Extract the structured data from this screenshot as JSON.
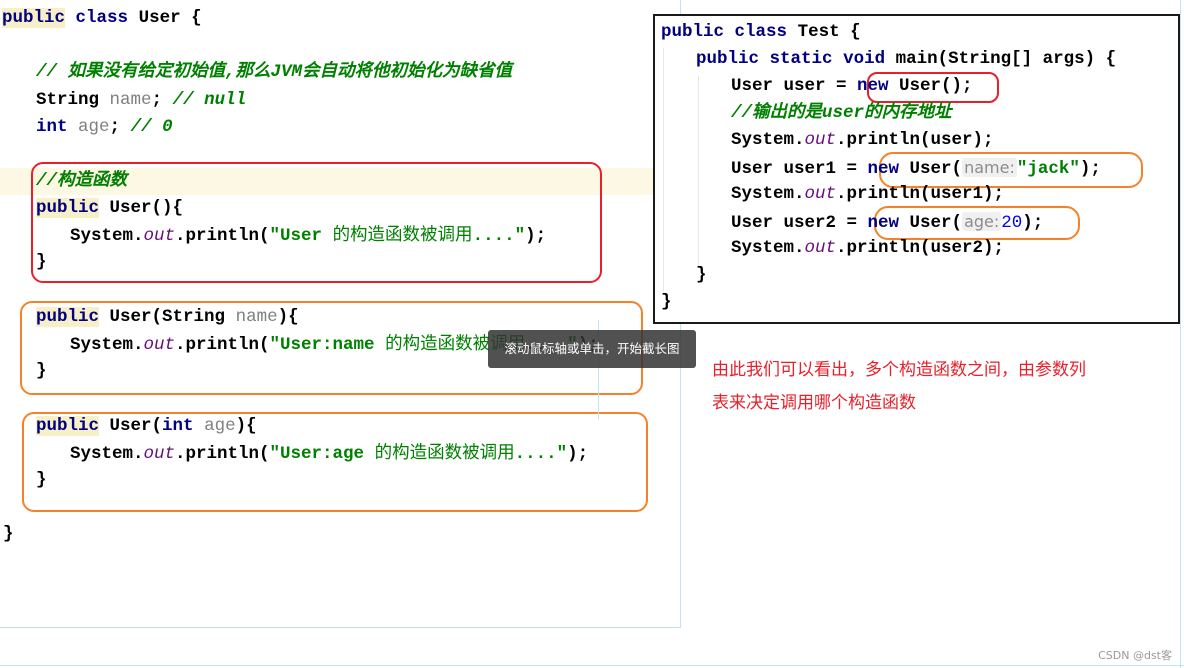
{
  "user_class": {
    "header": {
      "kw1": "public",
      "kw2": "class",
      "name": "User",
      "brace": "{"
    },
    "comment_default": "// 如果没有给定初始值,那么JVM会自动将他初始化为缺省值",
    "field_name": {
      "type": "String",
      "name": "name",
      "semi": ";",
      "comment": "// null"
    },
    "field_age": {
      "type": "int",
      "name": "age",
      "semi": ";",
      "comment": "// 0"
    },
    "ctor_comment": "//构造函数",
    "ctor_default": {
      "kw": "public",
      "sig": "User(){",
      "body_pre": "System.",
      "body_field": "out",
      "body_mid": ".println(",
      "str_pre": "\"User ",
      "str_cn": "的构造函数被调用",
      "str_post": "....\"",
      "body_end": ");",
      "close": "}"
    },
    "ctor_name": {
      "kw": "public",
      "sig_pre": "User(String ",
      "param": "name",
      "sig_post": "){",
      "body_pre": "System.",
      "body_field": "out",
      "body_mid": ".println(",
      "str_pre": "\"User:name ",
      "str_cn": "的构造函数被调用",
      "str_post": "....\"",
      "body_end": ");",
      "close": "}"
    },
    "ctor_age": {
      "kw": "public",
      "sig_pre": "User(",
      "sig_int": "int",
      "sig_space": " ",
      "param": "age",
      "sig_post": "){",
      "body_pre": "System.",
      "body_field": "out",
      "body_mid": ".println(",
      "str_pre": "\"User:age ",
      "str_cn": "的构造函数被调用",
      "str_post": "....\"",
      "body_end": ");",
      "close": "}"
    },
    "class_close": "}"
  },
  "test_class": {
    "header": {
      "kw1": "public",
      "kw2": "class",
      "name": "Test",
      "brace": "{"
    },
    "main": {
      "kw1": "public",
      "kw2": "static",
      "kw3": "void",
      "sig": "main(String[] args) {"
    },
    "line_user": {
      "pre": "User user = ",
      "kw": "new",
      "post": " User();"
    },
    "comment": "//输出的是user的内存地址",
    "print_user": {
      "pre": "System.",
      "field": "out",
      "post": ".println(user);"
    },
    "line_user1": {
      "pre": "User user1 = ",
      "kw": "new",
      "mid": " User(",
      "hint": "name:",
      "arg": "\"jack\"",
      "post": ");"
    },
    "print_user1": {
      "pre": "System.",
      "field": "out",
      "post": ".println(user1);"
    },
    "line_user2": {
      "pre": "User user2 = ",
      "kw": "new",
      "mid": " User(",
      "hint": "age:",
      "arg": "20",
      "post": ");"
    },
    "print_user2": {
      "pre": "System.",
      "field": "out",
      "post": ".println(user2);"
    },
    "main_close": "}",
    "class_close": "}"
  },
  "note": {
    "line1": "由此我们可以看出，多个构造函数之间，由参数列",
    "line2": "表来决定调用哪个构造函数"
  },
  "tooltip": "滚动鼠标轴或单击，开始截长图",
  "watermark": "CSDN @dst客",
  "colors": {
    "keyword": "#000080",
    "comment": "#008000",
    "field": "#660e7a",
    "param": "#808080",
    "number": "#0000ff",
    "box_red": "#e8202a",
    "box_orange": "#f5822a",
    "note": "#e8202a"
  }
}
